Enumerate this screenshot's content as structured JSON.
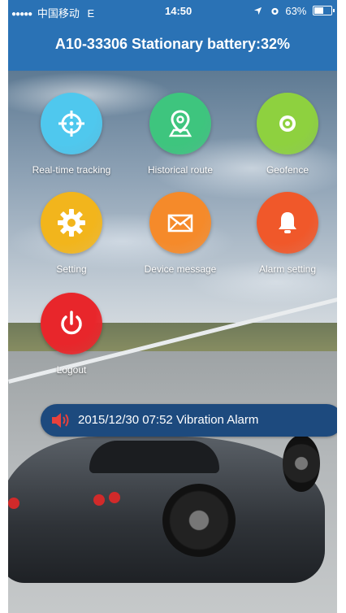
{
  "status_bar": {
    "signal": "●●●●●",
    "carrier": "中国移动",
    "network": "E",
    "time": "14:50",
    "battery_percent_text": "63%",
    "battery_level": 0.63
  },
  "header": {
    "title": "A10-33306 Stationary battery:32%",
    "background_color": "#2a72b5"
  },
  "menu": {
    "items": [
      {
        "label": "Real-time tracking",
        "icon": "crosshair-icon",
        "color": "#4fc8ee"
      },
      {
        "label": "Historical route",
        "icon": "map-pin-icon",
        "color": "#3ec57e"
      },
      {
        "label": "Geofence",
        "icon": "target-icon",
        "color": "#8ed13f"
      },
      {
        "label": "Setting",
        "icon": "gear-icon",
        "color": "#f2b51c"
      },
      {
        "label": "Device message",
        "icon": "envelope-icon",
        "color": "#f58a2a"
      },
      {
        "label": "Alarm setting",
        "icon": "bell-icon",
        "color": "#f0582a"
      },
      {
        "label": "Logout",
        "icon": "power-icon",
        "color": "#e8262b"
      }
    ]
  },
  "alarm_banner": {
    "text": "2015/12/30 07:52 Vibration Alarm",
    "icon": "speaker-icon",
    "background_color": "#1d4a7e"
  }
}
